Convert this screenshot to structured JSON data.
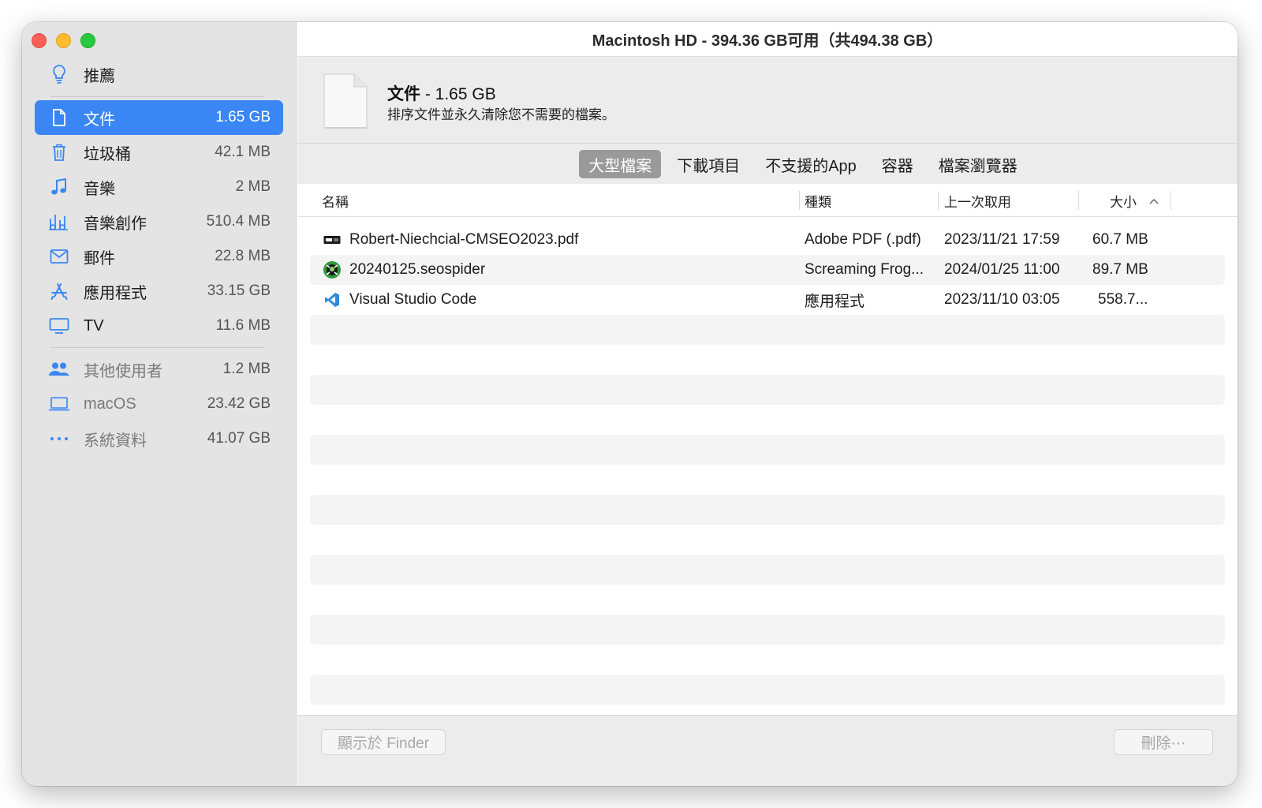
{
  "window": {
    "title": "Macintosh HD - 394.36 GB可用（共494.38 GB）"
  },
  "sidebar": {
    "recommend": {
      "label": "推薦",
      "icon": "lightbulb-icon"
    },
    "items": [
      {
        "label": "文件",
        "size": "1.65 GB",
        "icon": "document-icon",
        "selected": true
      },
      {
        "label": "垃圾桶",
        "size": "42.1 MB",
        "icon": "trash-icon"
      },
      {
        "label": "音樂",
        "size": "2 MB",
        "icon": "music-note-icon"
      },
      {
        "label": "音樂創作",
        "size": "510.4 MB",
        "icon": "music-creation-icon"
      },
      {
        "label": "郵件",
        "size": "22.8 MB",
        "icon": "mail-icon"
      },
      {
        "label": "應用程式",
        "size": "33.15 GB",
        "icon": "app-store-icon"
      },
      {
        "label": "TV",
        "size": "11.6 MB",
        "icon": "tv-icon"
      }
    ],
    "system_items": [
      {
        "label": "其他使用者",
        "size": "1.2 MB",
        "icon": "users-icon"
      },
      {
        "label": "macOS",
        "size": "23.42 GB",
        "icon": "laptop-icon"
      },
      {
        "label": "系統資料",
        "size": "41.07 GB",
        "icon": "ellipsis-icon"
      }
    ]
  },
  "header": {
    "title": "文件",
    "size": " - 1.65 GB",
    "description": "排序文件並永久清除您不需要的檔案。"
  },
  "tabs": [
    {
      "label": "大型檔案",
      "active": true
    },
    {
      "label": "下載項目"
    },
    {
      "label": "不支援的App"
    },
    {
      "label": "容器"
    },
    {
      "label": "檔案瀏覽器"
    }
  ],
  "table": {
    "columns": {
      "name": "名稱",
      "kind": "種類",
      "last_opened": "上一次取用",
      "size": "大小"
    },
    "rows": [
      {
        "name": "Robert-Niechcial-CMSEO2023.pdf",
        "kind": "Adobe PDF (.pdf)",
        "last_opened": "2023/11/21 17:59",
        "size": "60.7 MB",
        "icon": "pdf-icon"
      },
      {
        "name": "20240125.seospider",
        "kind": "Screaming Frog...",
        "last_opened": "2024/01/25 11:00",
        "size": "89.7 MB",
        "icon": "seospider-icon"
      },
      {
        "name": "Visual Studio Code",
        "kind": "應用程式",
        "last_opened": "2023/11/10 03:05",
        "size": "558.7...",
        "icon": "vscode-icon"
      }
    ]
  },
  "footer": {
    "finder_button": "顯示於 Finder",
    "delete_button": "刪除⋯"
  },
  "colors": {
    "accent": "#3a86f5",
    "sidebar_bg": "#e4e4e4",
    "active_tab": "#9a9a9a"
  }
}
